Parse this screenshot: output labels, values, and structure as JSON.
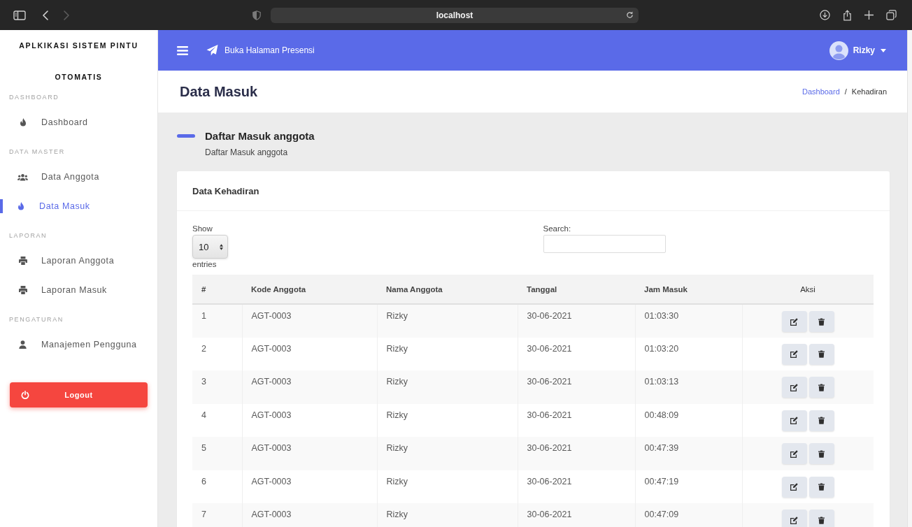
{
  "browser": {
    "nav_buttons": [
      {
        "kind": "back",
        "disabled": false
      },
      {
        "kind": "forward",
        "disabled": true
      }
    ],
    "address": "localhost"
  },
  "sidebar": {
    "brand": "APLKIKASI SISTEM PINTU OTOMATIS",
    "sections": [
      {
        "heading": "DASHBOARD",
        "items": [
          {
            "label": "Dashboard",
            "kind": "flame",
            "selected": false
          }
        ]
      },
      {
        "heading": "DATA MASTER",
        "items": [
          {
            "label": "Data Anggota",
            "kind": "people",
            "selected": false
          },
          {
            "label": "Data Masuk",
            "kind": "flame",
            "selected": true
          }
        ]
      },
      {
        "heading": "LAPORAN",
        "items": [
          {
            "label": "Laporan Anggota",
            "kind": "printer",
            "selected": false
          },
          {
            "label": "Laporan Masuk",
            "kind": "printer",
            "selected": false
          }
        ]
      },
      {
        "heading": "PENGATURAN",
        "items": [
          {
            "label": "Manajemen Pengguna",
            "kind": "person",
            "selected": false
          }
        ]
      }
    ],
    "logout": "Logout"
  },
  "topbar": {
    "link": "Buka Halaman Presensi",
    "user": "Rizky"
  },
  "page_header": {
    "title": "Data Masuk",
    "breadcrumb": {
      "items": [
        {
          "label": "Dashboard",
          "kind": "link"
        },
        {
          "label": "Kehadiran",
          "kind": "current"
        }
      ],
      "separator": "/"
    }
  },
  "section": {
    "title": "Daftar Masuk anggota",
    "subtitle": "Daftar Masuk anggota"
  },
  "card": {
    "title": "Data Kehadiran",
    "length_menu": {
      "label_before": "Show",
      "value": "10",
      "label_after": "entries"
    },
    "search": {
      "label": "Search:"
    },
    "table": {
      "columns": [
        "#",
        "Kode Anggota",
        "Nama Anggota",
        "Tanggal",
        "Jam Masuk",
        "Aksi"
      ],
      "rows": [
        {
          "cells": [
            "1",
            "AGT-0003",
            "Rizky",
            "30-06-2021",
            "01:03:30"
          ]
        },
        {
          "cells": [
            "2",
            "AGT-0003",
            "Rizky",
            "30-06-2021",
            "01:03:20"
          ]
        },
        {
          "cells": [
            "3",
            "AGT-0003",
            "Rizky",
            "30-06-2021",
            "01:03:13"
          ]
        },
        {
          "cells": [
            "4",
            "AGT-0003",
            "Rizky",
            "30-06-2021",
            "00:48:09"
          ]
        },
        {
          "cells": [
            "5",
            "AGT-0003",
            "Rizky",
            "30-06-2021",
            "00:47:39"
          ]
        },
        {
          "cells": [
            "6",
            "AGT-0003",
            "Rizky",
            "30-06-2021",
            "00:47:19"
          ]
        },
        {
          "cells": [
            "7",
            "AGT-0003",
            "Rizky",
            "30-06-2021",
            "00:47:09"
          ]
        }
      ]
    }
  }
}
